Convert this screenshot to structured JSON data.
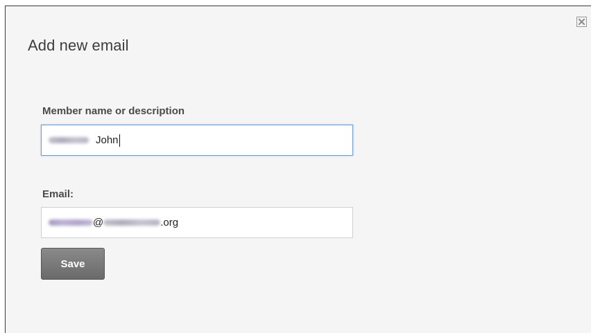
{
  "dialog": {
    "title": "Add new email",
    "close_icon": "close-icon"
  },
  "form": {
    "name_label": "Member name or description",
    "name_value_visible": "John",
    "email_label": "Email:",
    "email_at": "@",
    "email_suffix": ".org",
    "save_label": "Save"
  },
  "colors": {
    "focused_border": "#6f9fd2",
    "button_bg": "#6f6f6f",
    "dialog_bg": "#f5f5f5"
  }
}
